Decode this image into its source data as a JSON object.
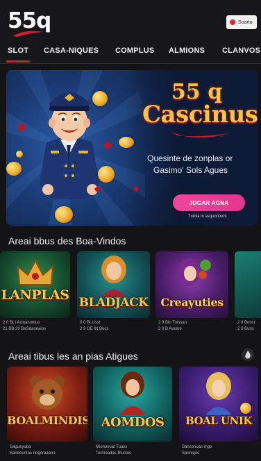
{
  "header": {
    "logo": "55q",
    "lang_label": "Soarto"
  },
  "nav": {
    "items": [
      "SLOT",
      "CASA-NIQUES",
      "COMPLUS",
      "ALMIONS",
      "CLANVOS"
    ]
  },
  "hero": {
    "title_line1": "55 q",
    "title_line2": "Cascinus",
    "subtitle_line1": "Quesinte de zonplas or",
    "subtitle_line2": "Gasimo' Sols Agues",
    "cta_label": "JOGAR AGNA",
    "cta_note": "Tumla lo asquontuos"
  },
  "section1": {
    "title": "Areai bbus des Boa-Vindos",
    "cards": [
      {
        "name": "LANPLAS",
        "caption1": "2 0 BLI Asinanontuo",
        "caption2": "21 BB 20 BaSdaonaios"
      },
      {
        "name": "BLADJACK",
        "caption1": "0 0 BLUsst",
        "caption2": "2 9 OE IN Bocs"
      },
      {
        "name": "Creayuties",
        "caption1": "2 0 Blo Tuissan",
        "caption2": "3 0 B Auxino"
      },
      {
        "name": "",
        "caption1": "2 0 Bnocr",
        "caption2": "2 0 Buns"
      }
    ]
  },
  "section2": {
    "title": "Areai tibus les an pias Atigues",
    "cards": [
      {
        "name": "BOALMINDIS",
        "caption1": "Sagueyuba",
        "caption2": "Saneeuntas nogoraaaoo"
      },
      {
        "name": "AOMDOS",
        "caption1": "Mionosuat Tuass",
        "caption2": "Tormoadas Blustos"
      },
      {
        "name": "BOAL UNIK",
        "caption1": "Sanconuas mgo",
        "caption2": "Sarinigos"
      }
    ]
  },
  "colors": {
    "background": "#141416",
    "accent": "#e01b34",
    "cta": "#ee4598",
    "gold": "#f4c54a"
  }
}
